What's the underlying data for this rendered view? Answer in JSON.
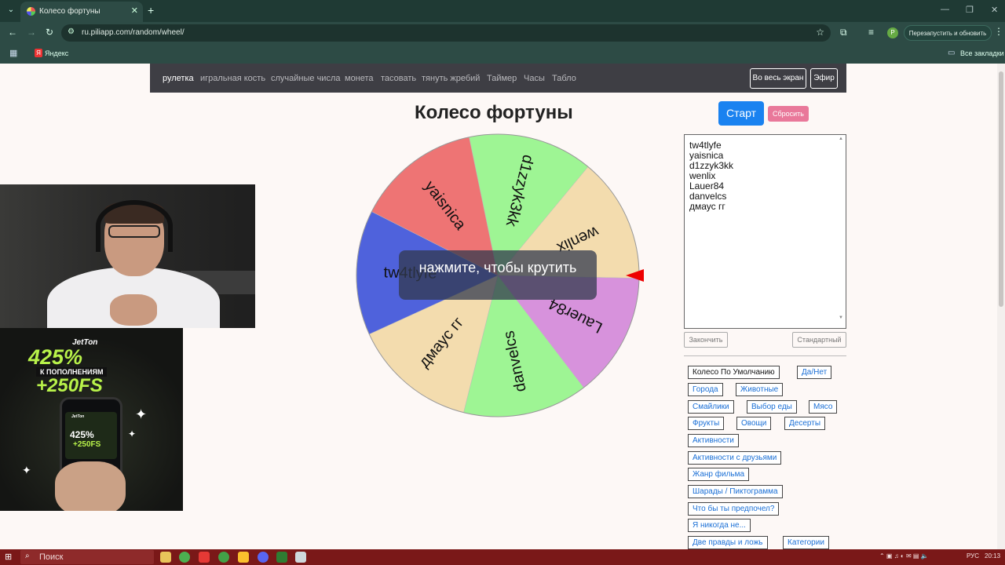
{
  "browser": {
    "tab_title": "Колесо фортуны",
    "url": "ru.piliapp.com/random/wheel/",
    "restart_label": "Перезапустить и обновить",
    "profile_initial": "P",
    "bookmark_yandex": "Яндекс",
    "all_bookmarks": "Все закладки"
  },
  "nav": {
    "links": [
      "рулетка",
      "игральная кость",
      "случайные числа",
      "монета",
      "тасовать",
      "тянуть жребий",
      "Таймер",
      "Часы",
      "Табло"
    ],
    "fullscreen": "Во весь экран",
    "live": "Эфир"
  },
  "main": {
    "title": "Колесо фортуны",
    "start": "Старт",
    "reset": "Сбросить",
    "overlay_text": "нажмите, чтобы крутить",
    "names_text": "tw4tlyfe\nyaisnica\nd1zzyk3kk\nwenlix\nLauer84\ndanvelcs\nдмаус гг",
    "finish": "Закончить",
    "standard": "Стандартный"
  },
  "wheel": {
    "rotation_deg": -10,
    "segments": [
      {
        "name": "d1zzyk3kk",
        "color": "#9ef594"
      },
      {
        "name": "wenlix",
        "color": "#f3dcae"
      },
      {
        "name": "Lauer84",
        "color": "#d792dc"
      },
      {
        "name": "danvelcs",
        "color": "#9ef594"
      },
      {
        "name": "дмаус гг",
        "color": "#f3dcae"
      },
      {
        "name": "tw4tlyfe",
        "color": "#4f62dc"
      },
      {
        "name": "yaisnica",
        "color": "#ee7474"
      }
    ]
  },
  "presets": [
    "Колесо По Умолчанию",
    "Да/Нет",
    "Города",
    "Животные",
    "Смайлики",
    "Выбор еды",
    "Мясо",
    "Фрукты",
    "Овощи",
    "Десерты",
    "Активности",
    "Активности с друзьями",
    "Жанр фильма",
    "Шарады / Пиктограмма",
    "Что бы ты предпочел?",
    "Я никогда не...",
    "Две правды и ложь",
    "Категории"
  ],
  "ad": {
    "logo": "JetTon",
    "big": "425%",
    "pill": "К ПОПОЛНЕНИЯМ",
    "fs": "+250FS",
    "phone_logo": "JetTon",
    "phone_big": "425%",
    "phone_fs": "+250FS"
  },
  "taskbar": {
    "search": "Поиск",
    "lang": "РУС",
    "time": "20:13"
  }
}
